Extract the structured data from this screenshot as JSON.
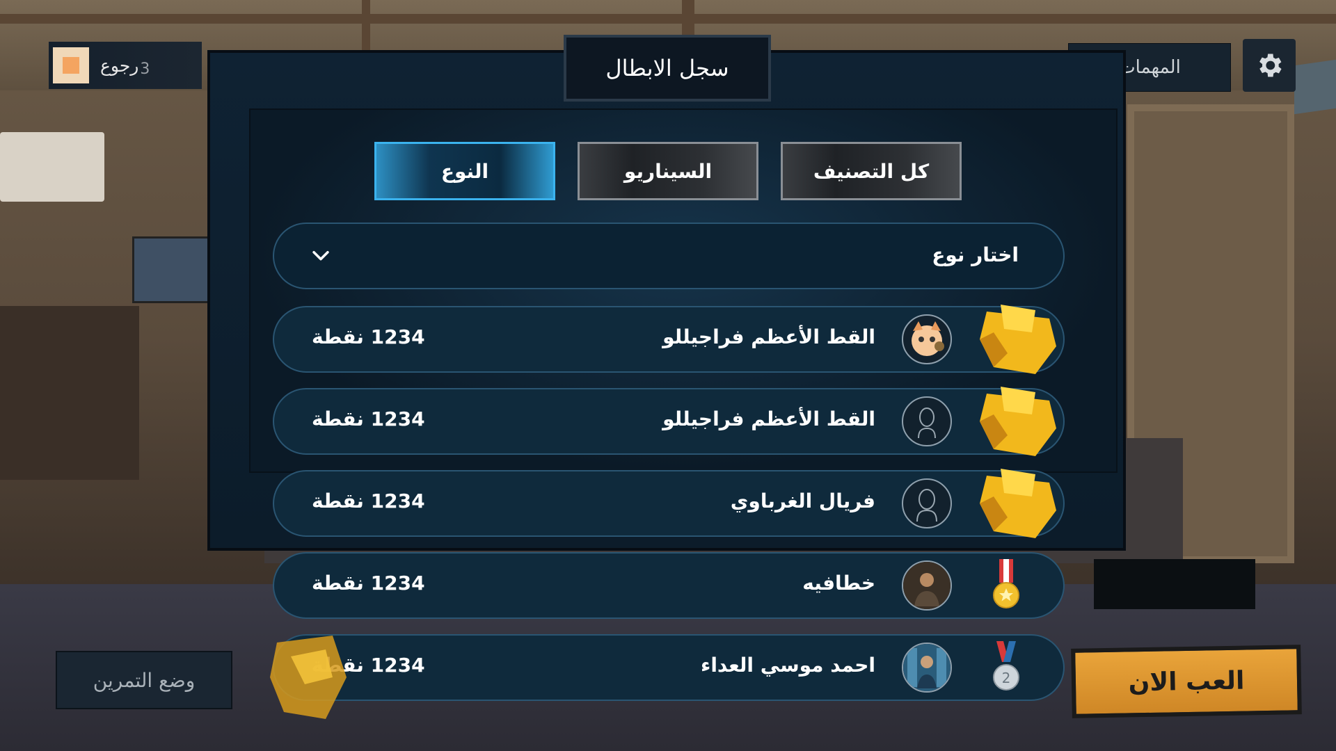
{
  "header": {
    "back_label": "رجوع",
    "back_badge": "3",
    "missions_label": "المهمات",
    "settings_icon": "gear-icon"
  },
  "panel": {
    "title": "سجل الابطال",
    "tabs": [
      {
        "label": "كل التصنيف",
        "active": false
      },
      {
        "label": "السيناريو",
        "active": false
      },
      {
        "label": "النوع",
        "active": true
      }
    ],
    "dropdown": {
      "selected": "اختار نوع",
      "icon": "chevron-down-icon"
    }
  },
  "leaderboard": [
    {
      "name": "القط الأعظم فراجيللو",
      "score": "1234 نقطة",
      "rank_icon": "gold-trophy-icon",
      "avatar": "cat-avatar"
    },
    {
      "name": "القط الأعظم فراجيللو",
      "score": "1234 نقطة",
      "rank_icon": "gold-trophy-icon",
      "avatar": "user-outline-avatar"
    },
    {
      "name": "فريال الغرباوي",
      "score": "1234 نقطة",
      "rank_icon": "gold-trophy-icon",
      "avatar": "user-outline-avatar"
    },
    {
      "name": "خطافيه",
      "score": "1234 نقطة",
      "rank_icon": "gold-medal-icon",
      "avatar": "photo-avatar"
    },
    {
      "name": "احمد موسي العداء",
      "score": "1234 نقطة",
      "rank_icon": "silver-medal-icon",
      "avatar": "photo-avatar"
    }
  ],
  "footer": {
    "practice_label": "وضع التمرين",
    "play_label": "العب الان"
  },
  "colors": {
    "accent": "#3bb3ee",
    "row_bg": "#0f2a3c",
    "row_border": "#2a5572",
    "play_button": "#e9a43a"
  }
}
